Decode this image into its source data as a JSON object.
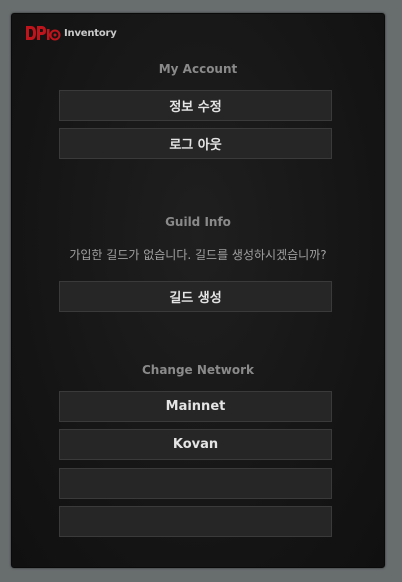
{
  "header": {
    "logo_text": "Inventory",
    "logo_mark_letters": "DP"
  },
  "account": {
    "title": "My Account",
    "edit_info_label": "정보 수정",
    "logout_label": "로그 아웃"
  },
  "guild": {
    "title": "Guild Info",
    "message": "가입한 길드가 없습니다. 길드를 생성하시겠습니까?",
    "create_label": "길드 생성"
  },
  "network": {
    "title": "Change Network",
    "options": [
      "Mainnet",
      "Kovan",
      "",
      ""
    ]
  },
  "colors": {
    "accent": "#c0141c",
    "panel_bg": "#161616",
    "button_bg": "#262626",
    "page_bg": "#686d6e"
  }
}
